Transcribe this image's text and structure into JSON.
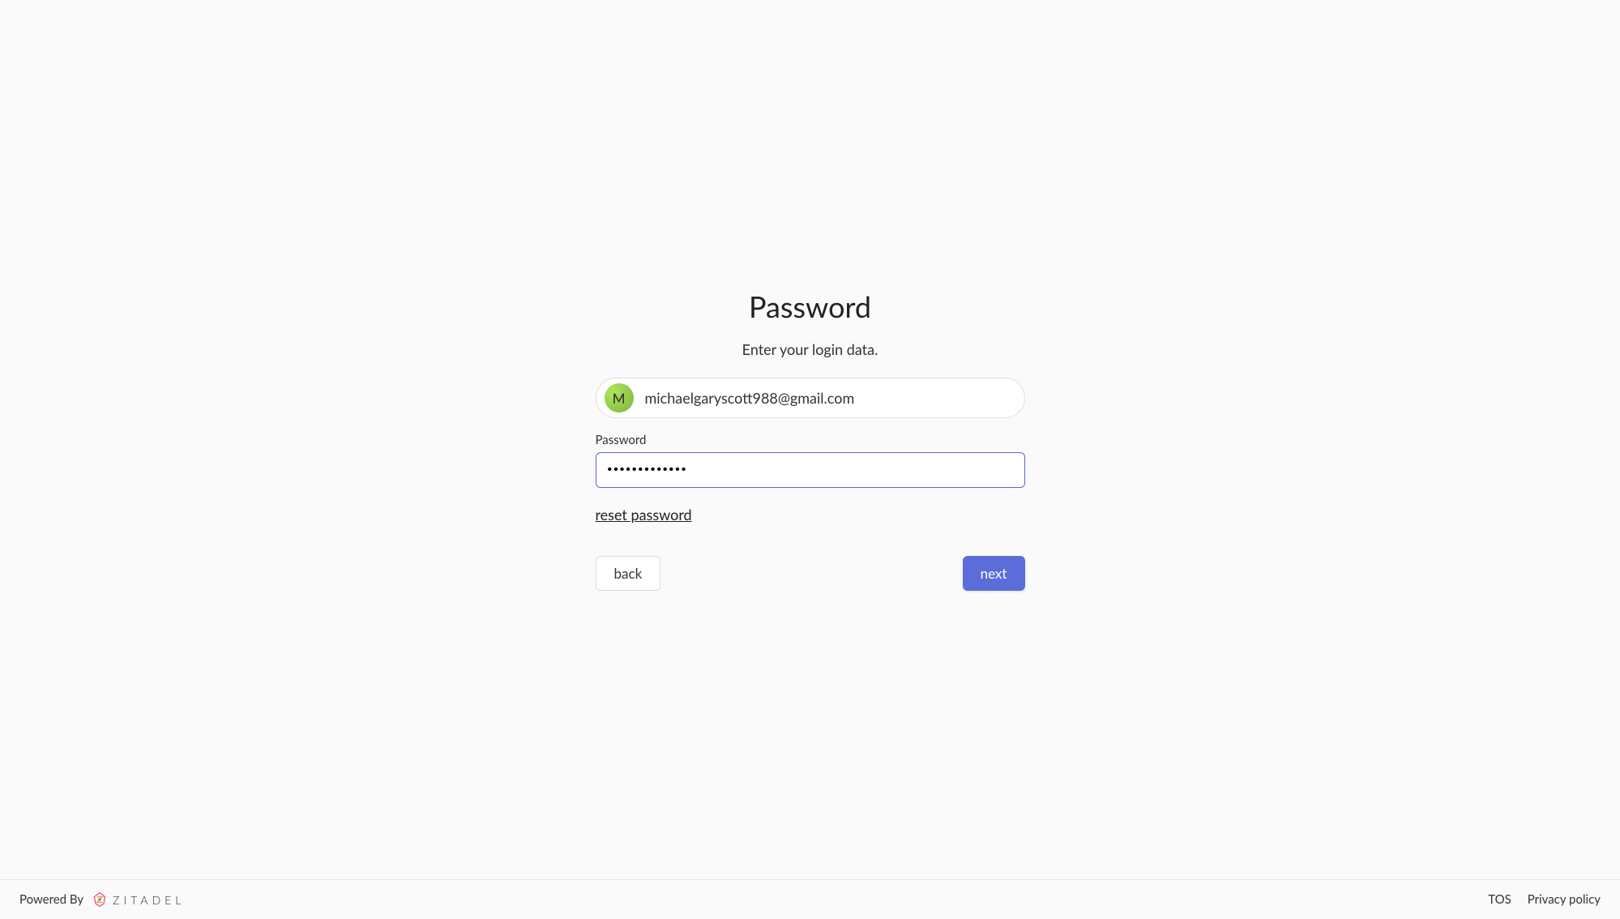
{
  "page": {
    "title": "Password",
    "subtitle": "Enter your login data."
  },
  "user": {
    "avatar_initial": "M",
    "email": "michaelgaryscott988@gmail.com"
  },
  "form": {
    "password_label": "Password",
    "password_value": "•••••••••••••",
    "reset_link_label": "reset password"
  },
  "buttons": {
    "back": "back",
    "next": "next"
  },
  "footer": {
    "powered_by": "Powered By",
    "brand": "ZITADEL",
    "tos": "TOS",
    "privacy": "Privacy policy"
  },
  "colors": {
    "primary": "#5b6dd8",
    "avatar_bg": "#8bc34a"
  }
}
